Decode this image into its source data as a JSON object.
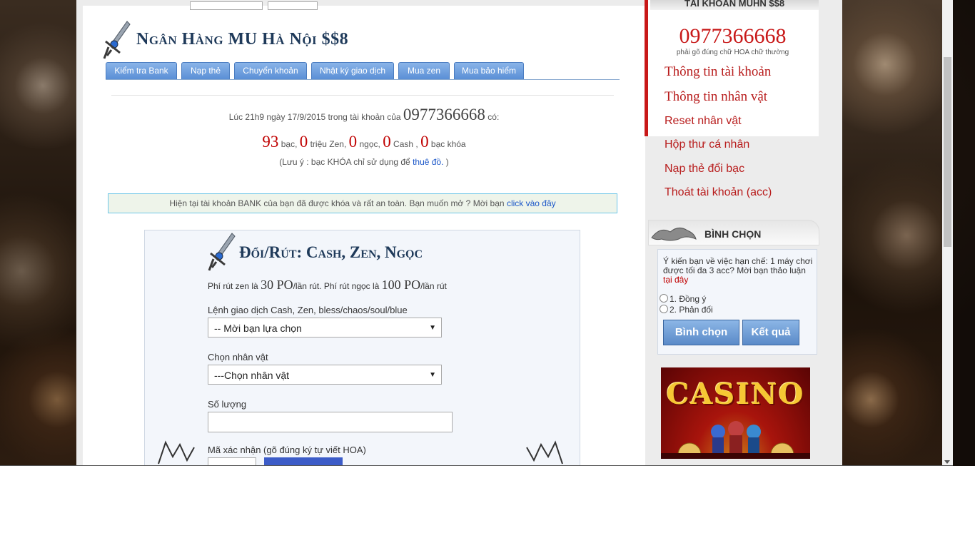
{
  "header": {
    "site_title": "Ngân Hàng MU Hà Nội $$8"
  },
  "tabs": [
    {
      "label": "Kiểm tra Bank"
    },
    {
      "label": "Nạp thẻ"
    },
    {
      "label": "Chuyển khoản"
    },
    {
      "label": "Nhật ký giao dịch"
    },
    {
      "label": "Mua zen"
    },
    {
      "label": "Mua bảo hiểm"
    }
  ],
  "summary": {
    "prefix": "Lúc 21h9 ngày 17/9/2015 trong tài khoản của",
    "account": "0977366668",
    "suffix": "có:",
    "bac_value": "93",
    "bac_unit": "bạc,",
    "zen_value": "0",
    "zen_unit": "triệu Zen,",
    "ngoc_value": "0",
    "ngoc_unit": "ngọc,",
    "cash_value": "0",
    "cash_unit": "Cash ,",
    "locked_value": "0",
    "locked_unit": "bạc khóa",
    "note_prefix": "(Lưu ý : bạc KHÓA chỉ sử dụng để",
    "note_link": "thuê đồ.",
    "note_suffix": ")"
  },
  "lock_notice": {
    "text": "Hiện tại tài khoản BANK của bạn đã được khóa và rất an toàn. Bạn muốn mở ? Mời bạn",
    "link": "click vào đây"
  },
  "form": {
    "title": "Đổi/Rút: Cash, Zen, Ngọc",
    "fee_1": "Phí rút zen là",
    "fee_zen": "30 PO",
    "fee_2": "/lần rút. Phí rút ngọc là",
    "fee_ngoc": "100 PO",
    "fee_3": "/lần rút",
    "command_label": "Lệnh giao dịch Cash, Zen, bless/chaos/soul/blue",
    "command_selected": "-- Mời bạn lựa chọn",
    "character_label": "Chọn nhân vật",
    "character_selected": "---Chọn nhân vật",
    "quantity_label": "Số lượng",
    "quantity_value": "",
    "captcha_label": "Mã xác nhận (gõ đúng ký tự viết HOA)"
  },
  "sidebar": {
    "account_header": "TÀI KHOẢN MUHN $$8",
    "account_number": "0977366668",
    "account_hint": "phải gõ đúng chữ HOA chữ thường",
    "links": [
      {
        "label": "Thông tin tài khoản"
      },
      {
        "label": "Thông tin nhân vật"
      },
      {
        "label": "Reset nhân vật"
      },
      {
        "label": "Hộp thư cá nhân"
      },
      {
        "label": "Nạp thẻ đổi bạc"
      },
      {
        "label": "Thoát tài khoản (acc)"
      }
    ],
    "vote_header": "BÌNH CHỌN",
    "vote_question": "Ý kiến bạn về việc hạn chế: 1 máy chơi được tối đa 3 acc? Mời bạn thảo luận",
    "vote_link": "tại đây",
    "vote_options": [
      {
        "label": "1. Đồng ý"
      },
      {
        "label": "2. Phản đối"
      }
    ],
    "vote_button": "Bình chọn",
    "result_button": "Kết quả",
    "banner_text": "CASINO"
  },
  "colors": {
    "accent_red": "#c81818",
    "link_blue": "#1a56c8",
    "tab_blue": "#5a8fd6",
    "title_navy": "#1f3a5a"
  }
}
